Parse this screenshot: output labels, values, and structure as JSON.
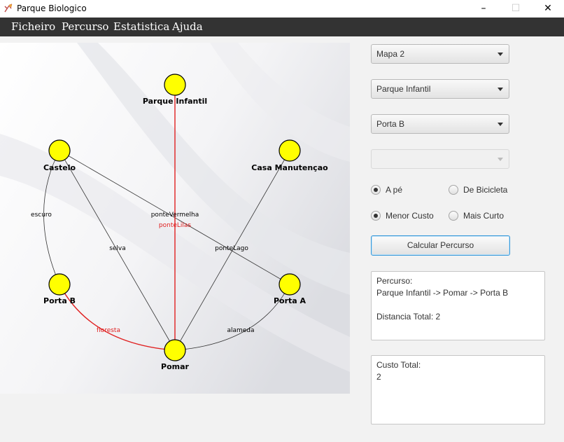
{
  "window": {
    "title": "Parque Biologico",
    "minimize_symbol": "–",
    "maximize_symbol": "☐",
    "close_symbol": "✕"
  },
  "menu": {
    "items": [
      "Ficheiro",
      "Percurso",
      "Estatistica",
      "Ajuda"
    ]
  },
  "map": {
    "nodes": {
      "parque_infantil": "Parque Infantil",
      "castelo": "Castelo",
      "casa_manutencao": "Casa Manutençao",
      "porta_b": "Porta B",
      "porta_a": "Porta A",
      "pomar": "Pomar"
    },
    "edges": {
      "escuro": "escuro",
      "ponte_vermelha": "ponteVermelha",
      "ponte_lilas": "ponteLilas",
      "selva": "selva",
      "ponte_lago": "ponteLago",
      "floresta": "floresta",
      "alameda": "alameda"
    },
    "colors": {
      "node_fill": "#ffff00",
      "highlight": "#e02020",
      "edge": "#333333"
    }
  },
  "controls": {
    "map_select": "Mapa 2",
    "origin_select": "Parque Infantil",
    "destination_select": "Porta B",
    "extra_select": "",
    "mode_walk": "A pé",
    "mode_bike": "De Bicicleta",
    "criterion_cost": "Menor Custo",
    "criterion_short": "Mais Curto",
    "calculate_button": "Calcular Percurso"
  },
  "result": {
    "route_title": "Percurso:",
    "route_path": "Parque Infantil -> Pomar -> Porta B",
    "distance": "Distancia Total: 2",
    "cost_title": "Custo Total:",
    "cost_value": "2"
  }
}
